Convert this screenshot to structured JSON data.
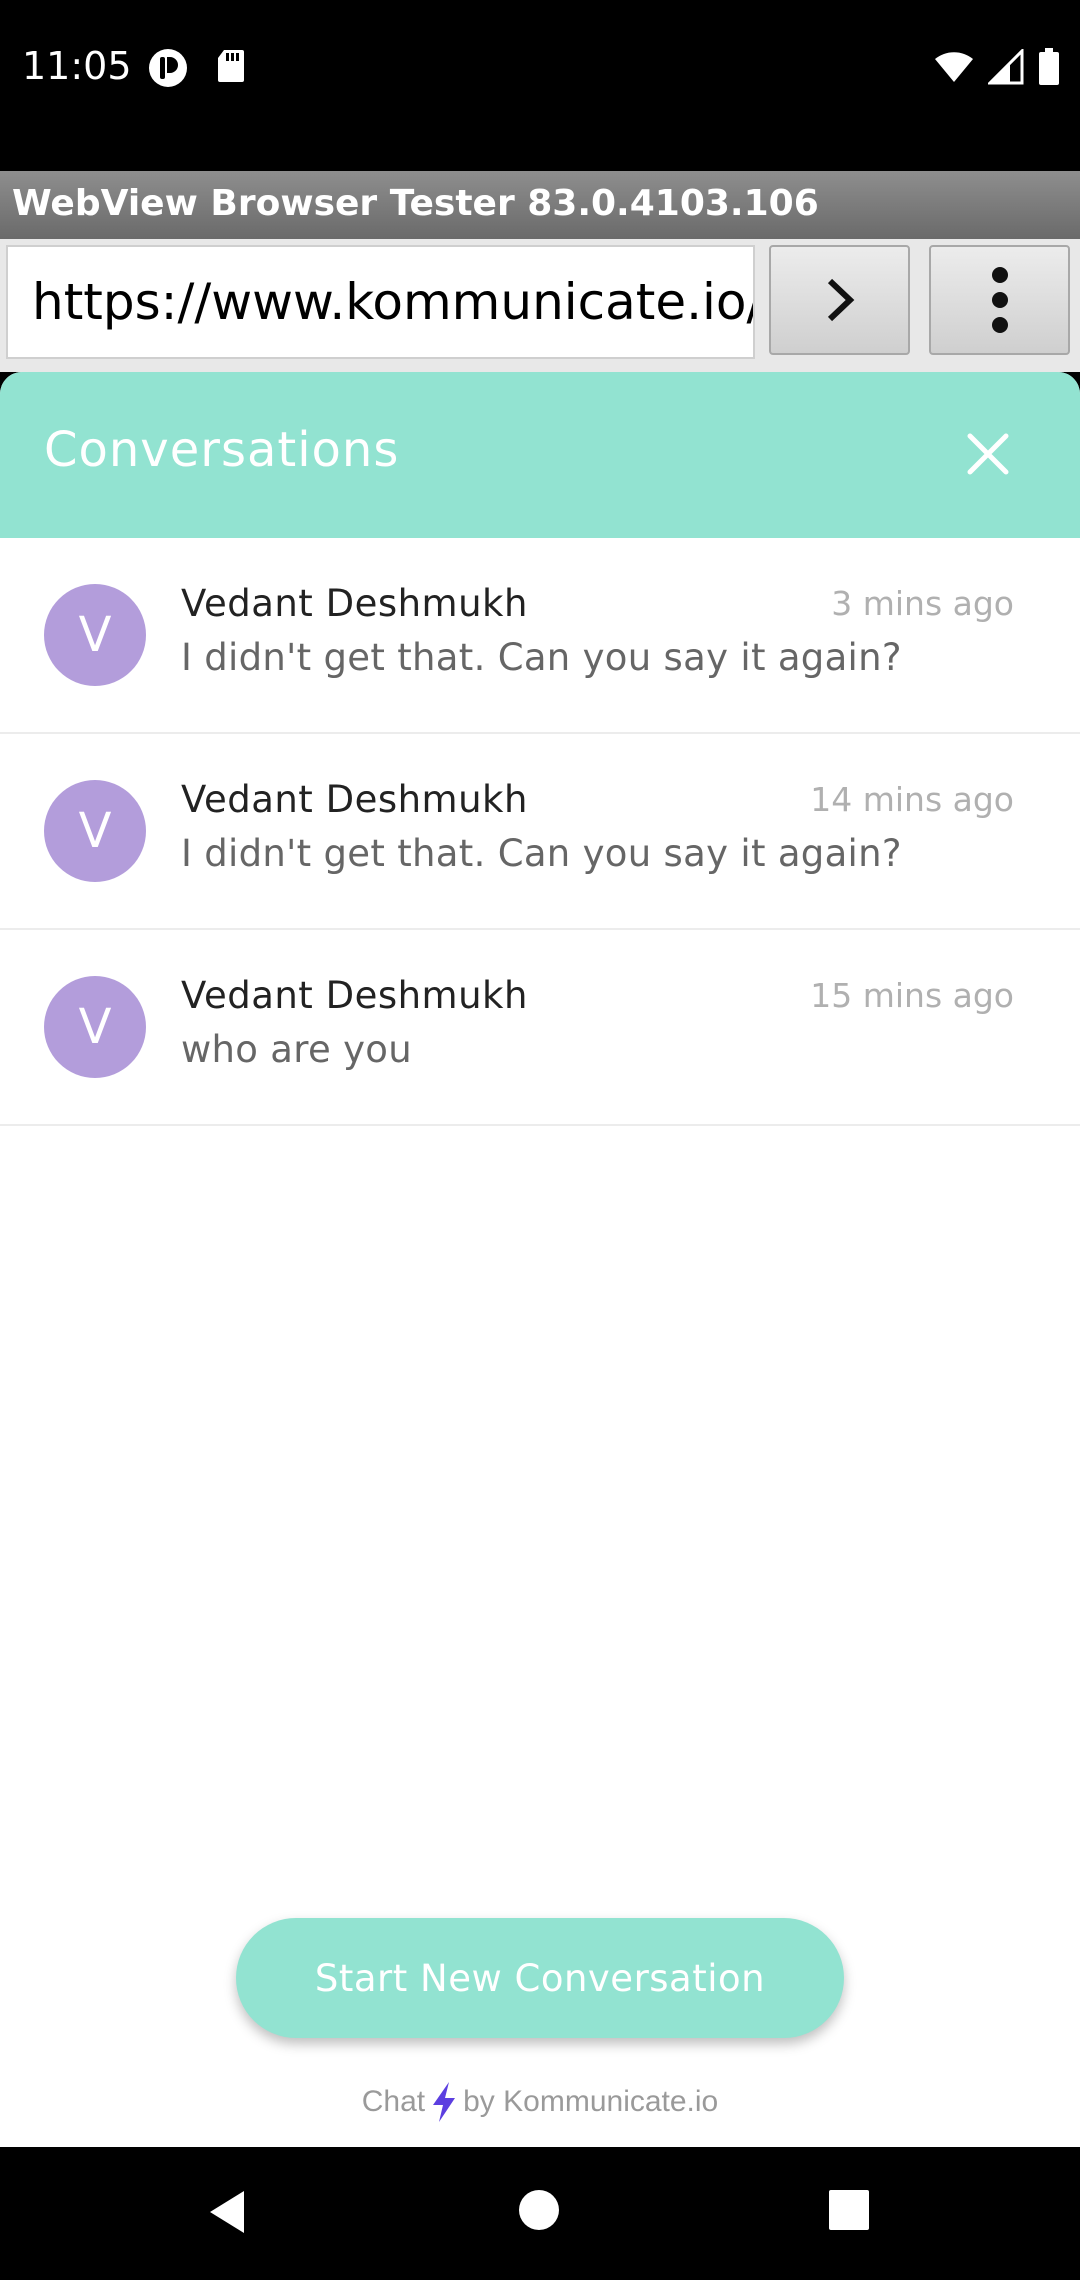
{
  "status_bar": {
    "time": "11:05",
    "icons_left": [
      "privacy-dot-icon",
      "sd-card-icon"
    ],
    "icons_right": [
      "wifi-icon",
      "signal-icon",
      "battery-icon"
    ]
  },
  "browser": {
    "title": "WebView Browser Tester 83.0.4103.106",
    "url": "https://www.kommunicate.io/live",
    "go_icon": "chevron-right-icon",
    "menu_icon": "more-vertical-icon"
  },
  "widget": {
    "header_title": "Conversations",
    "header_color": "#92e3d1",
    "conversations": [
      {
        "initial": "V",
        "name": "Vedant Deshmukh",
        "time": "3 mins ago",
        "message": "I didn't get that. Can you say it again?"
      },
      {
        "initial": "V",
        "name": "Vedant Deshmukh",
        "time": "14 mins ago",
        "message": "I didn't get that. Can you say it again?"
      },
      {
        "initial": "V",
        "name": "Vedant Deshmukh",
        "time": "15 mins ago",
        "message": "who are you"
      }
    ],
    "avatar_color": "#b39ddb",
    "start_button_label": "Start New Conversation",
    "powered_prefix": "Chat",
    "powered_suffix": "by Kommunicate.io",
    "powered_icon": "lightning-bolt-icon",
    "powered_icon_color": "#5c3fe0"
  },
  "nav_bar": {
    "icons": [
      "back-icon",
      "home-icon",
      "recents-icon"
    ]
  }
}
